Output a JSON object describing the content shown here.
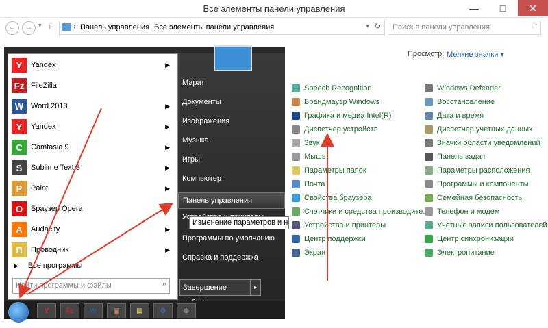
{
  "window": {
    "title": "Все элементы панели управления",
    "minimize": "—",
    "maximize": "□",
    "close": "✕"
  },
  "address": {
    "breadcrumb": [
      "Панель управления",
      "Все элементы панели управления"
    ],
    "search_placeholder": "Поиск в панели управления"
  },
  "view": {
    "label": "Просмотр:",
    "value": "Мелкие значки ▾"
  },
  "cp_left": [
    {
      "label": "Speech Recognition",
      "color": "#5a9"
    },
    {
      "label": "Брандмауэр Windows",
      "color": "#c84"
    },
    {
      "label": "Графика и медиа Intel(R)",
      "color": "#248"
    },
    {
      "label": "Диспетчер устройств",
      "color": "#888"
    },
    {
      "label": "Звук",
      "color": "#aaa"
    },
    {
      "label": "Мышь",
      "color": "#999"
    },
    {
      "label": "Параметры папок",
      "color": "#dc6"
    },
    {
      "label": "Почта",
      "color": "#58c"
    },
    {
      "label": "Свойства браузера",
      "color": "#39c"
    },
    {
      "label": "Счетчики и средства производите...",
      "color": "#6a6"
    },
    {
      "label": "Устройства и принтеры",
      "color": "#557"
    },
    {
      "label": "Центр поддержки",
      "color": "#36a"
    },
    {
      "label": "Экран",
      "color": "#468"
    }
  ],
  "cp_right": [
    {
      "label": "Windows Defender",
      "color": "#777"
    },
    {
      "label": "Восстановление",
      "color": "#69b"
    },
    {
      "label": "Дата и время",
      "color": "#68a"
    },
    {
      "label": "Диспетчер учетных данных",
      "color": "#a96"
    },
    {
      "label": "Значки области уведомлений",
      "color": "#777"
    },
    {
      "label": "Панель задач",
      "color": "#555"
    },
    {
      "label": "Параметры расположения",
      "color": "#8a8"
    },
    {
      "label": "Программы и компоненты",
      "color": "#888"
    },
    {
      "label": "Семейная безопасность",
      "color": "#7a5"
    },
    {
      "label": "Телефон и модем",
      "color": "#999"
    },
    {
      "label": "Учетные записи пользователей",
      "color": "#5a8"
    },
    {
      "label": "Центр синхронизации",
      "color": "#3a4"
    },
    {
      "label": "Электропитание",
      "color": "#4a6"
    }
  ],
  "start": {
    "apps": [
      {
        "label": "Yandex",
        "icon": "Y",
        "color": "#e22",
        "arrow": true
      },
      {
        "label": "FileZilla",
        "icon": "Fz",
        "color": "#b22",
        "arrow": false
      },
      {
        "label": "Word 2013",
        "icon": "W",
        "color": "#2b579a",
        "arrow": true
      },
      {
        "label": "Yandex",
        "icon": "Y",
        "color": "#e22",
        "arrow": true
      },
      {
        "label": "Camtasia 9",
        "icon": "C",
        "color": "#3a3",
        "arrow": true
      },
      {
        "label": "Sublime Text 3",
        "icon": "S",
        "color": "#444",
        "arrow": true
      },
      {
        "label": "Paint",
        "icon": "P",
        "color": "#d93",
        "arrow": true
      },
      {
        "label": "Браузер Opera",
        "icon": "O",
        "color": "#d11",
        "arrow": false
      },
      {
        "label": "Audacity",
        "icon": "A",
        "color": "#f70",
        "arrow": true
      },
      {
        "label": "Проводник",
        "icon": "П",
        "color": "#db4",
        "arrow": true
      }
    ],
    "all_programs": "Все программы",
    "search_placeholder": "Найти программы и файлы",
    "right_items": [
      "Марат",
      "Документы",
      "Изображения",
      "Музыка",
      "Игры",
      "Компьютер",
      "Панель управления",
      "Устройства и принтеры",
      "Программы по умолчанию",
      "Справка и поддержка"
    ],
    "tooltip": "Изменение параметров и настройка функциональных возможностей компьютера",
    "shutdown": "Завершение работы",
    "shutdown_arrow": "▸",
    "taskbar": [
      "Y",
      "Fz",
      "W",
      "▣",
      "▤",
      "⚙",
      "⊛"
    ]
  }
}
